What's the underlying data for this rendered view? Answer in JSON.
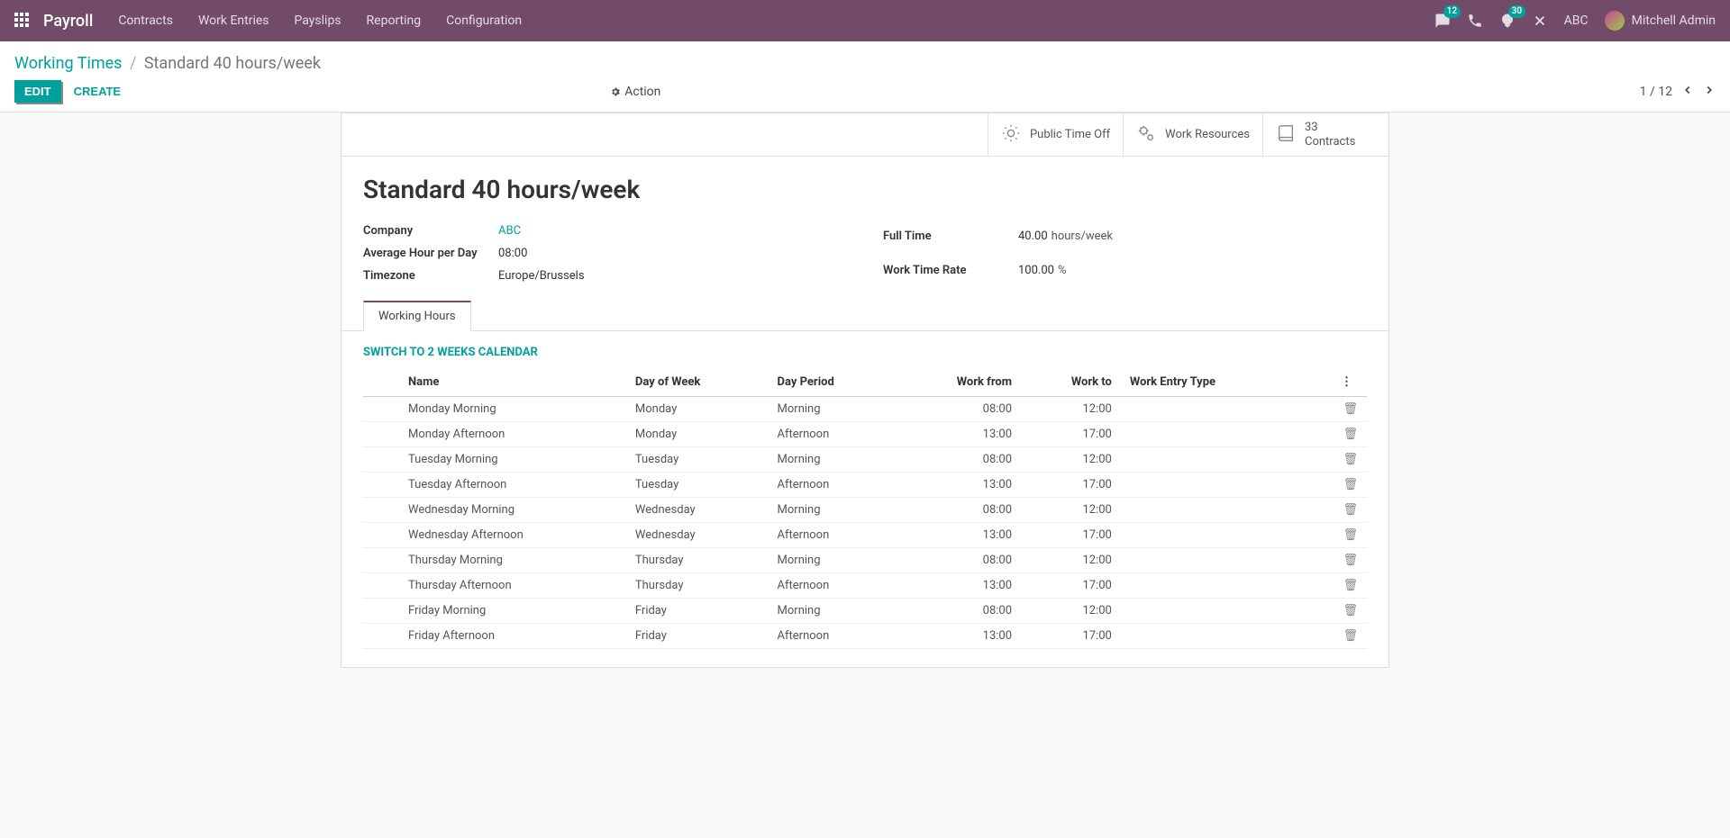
{
  "navbar": {
    "brand": "Payroll",
    "menu": [
      "Contracts",
      "Work Entries",
      "Payslips",
      "Reporting",
      "Configuration"
    ],
    "messages_badge": "12",
    "activities_badge": "30",
    "company": "ABC",
    "user": "Mitchell Admin"
  },
  "breadcrumb": {
    "parent": "Working Times",
    "current": "Standard 40 hours/week"
  },
  "buttons": {
    "edit": "EDIT",
    "create": "CREATE",
    "action": "Action"
  },
  "pager": {
    "text": "1 / 12"
  },
  "stat_buttons": [
    {
      "value": "",
      "label": "Public Time Off",
      "icon": "sun"
    },
    {
      "value": "",
      "label": "Work Resources",
      "icon": "cogs"
    },
    {
      "value": "33",
      "label": "Contracts",
      "icon": "book"
    }
  ],
  "record": {
    "title": "Standard 40 hours/week",
    "fields_left": [
      {
        "label": "Company",
        "value": "ABC",
        "link": true
      },
      {
        "label": "Average Hour per Day",
        "value": "08:00"
      },
      {
        "label": "Timezone",
        "value": "Europe/Brussels"
      }
    ],
    "fields_right": [
      {
        "label": "Full Time",
        "value": "40.00",
        "unit": "hours/week"
      },
      {
        "label": "Work Time Rate",
        "value": "100.00",
        "unit": "%"
      }
    ]
  },
  "tab": {
    "label": "Working Hours"
  },
  "switch_link": "Switch to 2 weeks calendar",
  "table": {
    "headers": [
      "Name",
      "Day of Week",
      "Day Period",
      "Work from",
      "Work to",
      "Work Entry Type"
    ],
    "rows": [
      {
        "name": "Monday Morning",
        "dow": "Monday",
        "period": "Morning",
        "from": "08:00",
        "to": "12:00",
        "type": ""
      },
      {
        "name": "Monday Afternoon",
        "dow": "Monday",
        "period": "Afternoon",
        "from": "13:00",
        "to": "17:00",
        "type": ""
      },
      {
        "name": "Tuesday Morning",
        "dow": "Tuesday",
        "period": "Morning",
        "from": "08:00",
        "to": "12:00",
        "type": ""
      },
      {
        "name": "Tuesday Afternoon",
        "dow": "Tuesday",
        "period": "Afternoon",
        "from": "13:00",
        "to": "17:00",
        "type": ""
      },
      {
        "name": "Wednesday Morning",
        "dow": "Wednesday",
        "period": "Morning",
        "from": "08:00",
        "to": "12:00",
        "type": ""
      },
      {
        "name": "Wednesday Afternoon",
        "dow": "Wednesday",
        "period": "Afternoon",
        "from": "13:00",
        "to": "17:00",
        "type": ""
      },
      {
        "name": "Thursday Morning",
        "dow": "Thursday",
        "period": "Morning",
        "from": "08:00",
        "to": "12:00",
        "type": ""
      },
      {
        "name": "Thursday Afternoon",
        "dow": "Thursday",
        "period": "Afternoon",
        "from": "13:00",
        "to": "17:00",
        "type": ""
      },
      {
        "name": "Friday Morning",
        "dow": "Friday",
        "period": "Morning",
        "from": "08:00",
        "to": "12:00",
        "type": ""
      },
      {
        "name": "Friday Afternoon",
        "dow": "Friday",
        "period": "Afternoon",
        "from": "13:00",
        "to": "17:00",
        "type": ""
      }
    ]
  }
}
